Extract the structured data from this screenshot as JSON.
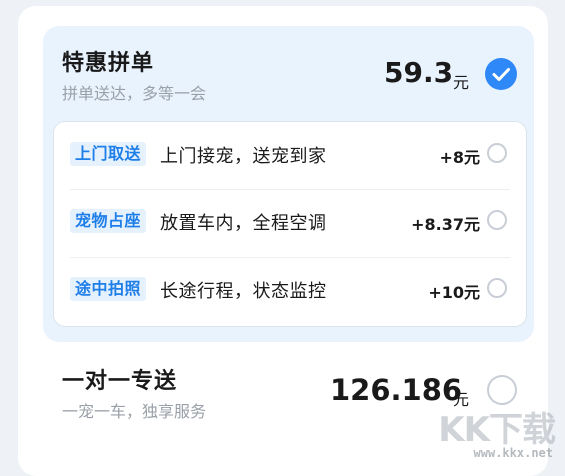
{
  "options": [
    {
      "title": "特惠拼单",
      "subtitle": "拼单送达，多等一会",
      "price": "59.3",
      "unit": "元",
      "selected": true
    },
    {
      "title": "一对一专送",
      "subtitle": "一宠一车，独享服务",
      "price": "126.186",
      "unit": "元",
      "selected": false
    }
  ],
  "addons": [
    {
      "tag": "上门取送",
      "desc": "上门接宠，送宠到家",
      "price": "+8元",
      "selected": false
    },
    {
      "tag": "宠物占座",
      "desc": "放置车内，全程空调",
      "price": "+8.37元",
      "selected": false
    },
    {
      "tag": "途中拍照",
      "desc": "长途行程，状态监控",
      "price": "+10元",
      "selected": false
    }
  ],
  "colors": {
    "accent": "#2f88f7",
    "tag_text": "#1f7fe8",
    "tag_bg": "#e6f1fe",
    "selected_bg": "#e9f3fe"
  },
  "icons": {
    "selected": "checkmark-circle-icon",
    "unselected": "radio-empty-icon"
  },
  "watermark": {
    "text": "KK下载",
    "url": "www.kkx.net"
  }
}
